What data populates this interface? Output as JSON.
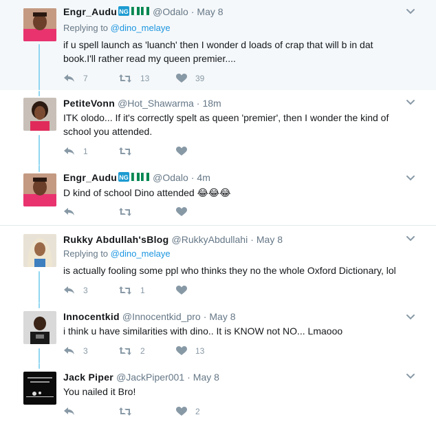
{
  "tweets": [
    {
      "name": "Engr_Audu",
      "country_badge": "NG",
      "handle": "@Odalo",
      "time": "May 8",
      "replying_prefix": "Replying to ",
      "replying_to": "@dino_melaye",
      "text": "if u spell launch as 'luanch' then I wonder d loads of crap that will b in dat book.I'll rather read my queen premier....",
      "replies": "7",
      "retweets": "13",
      "likes": "39"
    },
    {
      "name": "PetiteVonn",
      "handle": "@Hot_Shawarma",
      "time": "18m",
      "text": "ITK olodo... If it's correctly spelt as queen 'premier', then I wonder the kind of school you attended.",
      "replies": "1",
      "retweets": "",
      "likes": ""
    },
    {
      "name": "Engr_Audu",
      "country_badge": "NG",
      "handle": "@Odalo",
      "time": "4m",
      "text": "D kind of school Dino attended 😂😂😂",
      "replies": "",
      "retweets": "",
      "likes": ""
    },
    {
      "name": "Rukky Abdullah'sBlog",
      "handle": "@RukkyAbdullahi",
      "time": "May 8",
      "replying_prefix": "Replying to ",
      "replying_to": "@dino_melaye",
      "text": "is actually fooling some ppl who thinks they no the whole Oxford Dictionary, lol",
      "replies": "3",
      "retweets": "1",
      "likes": ""
    },
    {
      "name": "Innocentkid",
      "handle": "@Innocentkid_pro",
      "time": "May 8",
      "text": "i think u have similarities with dino.. It is KNOW not NO... Lmaooo",
      "replies": "3",
      "retweets": "2",
      "likes": "13"
    },
    {
      "name": "Jack Piper",
      "handle": "@JackPiper001",
      "time": "May 8",
      "text": "You nailed it Bro!",
      "replies": "",
      "retweets": "",
      "likes": "2"
    }
  ],
  "icons": {
    "reply": "reply-icon",
    "retweet": "retweet-icon",
    "like": "heart-icon",
    "more": "chevron-down-icon"
  },
  "colors": {
    "link": "#1b95e0",
    "thread_line": "#8fd6f0",
    "muted": "#657786",
    "icon": "#8899a6",
    "highlight_bg": "#f5f8fa",
    "separator": "#e1e8ed"
  }
}
